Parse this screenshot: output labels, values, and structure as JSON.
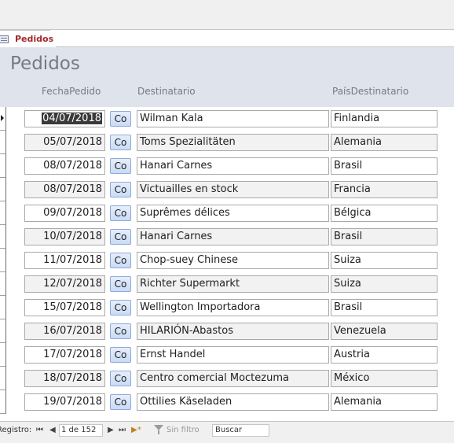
{
  "tab": {
    "label": "Pedidos"
  },
  "form": {
    "title": "Pedidos"
  },
  "columns": {
    "fecha": "FechaPedido",
    "destinatario": "Destinatario",
    "pais": "PaísDestinatario"
  },
  "co_label": "Co",
  "rows": [
    {
      "fecha": "04/07/2018",
      "destinatario": "Wilman Kala",
      "pais": "Finlandia"
    },
    {
      "fecha": "05/07/2018",
      "destinatario": "Toms Spezialitäten",
      "pais": "Alemania"
    },
    {
      "fecha": "08/07/2018",
      "destinatario": "Hanari Carnes",
      "pais": "Brasil"
    },
    {
      "fecha": "08/07/2018",
      "destinatario": "Victuailles en stock",
      "pais": "Francia"
    },
    {
      "fecha": "09/07/2018",
      "destinatario": "Suprêmes délices",
      "pais": "Bélgica"
    },
    {
      "fecha": "10/07/2018",
      "destinatario": "Hanari Carnes",
      "pais": "Brasil"
    },
    {
      "fecha": "11/07/2018",
      "destinatario": "Chop-suey Chinese",
      "pais": "Suiza"
    },
    {
      "fecha": "12/07/2018",
      "destinatario": "Richter Supermarkt",
      "pais": "Suiza"
    },
    {
      "fecha": "15/07/2018",
      "destinatario": "Wellington Importadora",
      "pais": "Brasil"
    },
    {
      "fecha": "16/07/2018",
      "destinatario": "HILARIÓN-Abastos",
      "pais": "Venezuela"
    },
    {
      "fecha": "17/07/2018",
      "destinatario": "Ernst Handel",
      "pais": "Austria"
    },
    {
      "fecha": "18/07/2018",
      "destinatario": "Centro comercial Moctezuma",
      "pais": "México"
    },
    {
      "fecha": "19/07/2018",
      "destinatario": "Ottilies Käseladen",
      "pais": "Alemania"
    }
  ],
  "nav": {
    "record_label": "Registro:",
    "first": "⏮",
    "prev": "◀",
    "current": "1 de 152",
    "next": "▶",
    "last": "⏭",
    "new": "▶*",
    "filter_label": "Sin filtro",
    "search_value": "Buscar"
  }
}
